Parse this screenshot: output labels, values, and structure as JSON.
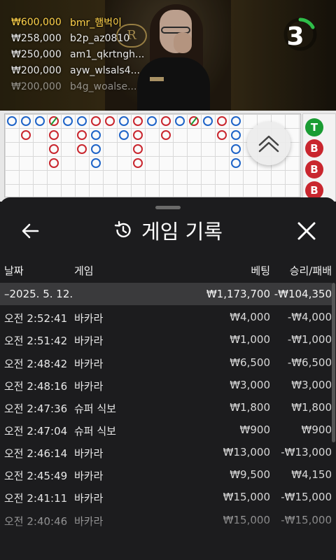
{
  "video": {
    "crest_letter": "R",
    "timer": "3",
    "winners": [
      {
        "amount": "₩600,000",
        "name": "bmr_햄벅이"
      },
      {
        "amount": "₩258,000",
        "name": "b2p_az0810"
      },
      {
        "amount": "₩250,000",
        "name": "am1_qkrtngh..."
      },
      {
        "amount": "₩200,000",
        "name": "ayw_wlsals4..."
      },
      {
        "amount": "₩200,000",
        "name": "b4g_woalse..."
      }
    ]
  },
  "side_road": {
    "labels": [
      "T",
      "B",
      "B",
      "B"
    ]
  },
  "panel": {
    "title": "게임 기록",
    "columns": {
      "date": "날짜",
      "game": "게임",
      "bet": "베팅",
      "result": "승리/패배"
    },
    "day": {
      "date": "–2025. 5. 12.",
      "bet": "₩1,173,700",
      "result": "-₩104,350"
    },
    "rows": [
      {
        "time": "오전 2:52:41",
        "game": "바카라",
        "bet": "₩4,000",
        "result": "-₩4,000"
      },
      {
        "time": "오전 2:51:42",
        "game": "바카라",
        "bet": "₩1,000",
        "result": "-₩1,000"
      },
      {
        "time": "오전 2:48:42",
        "game": "바카라",
        "bet": "₩6,500",
        "result": "-₩6,500"
      },
      {
        "time": "오전 2:48:16",
        "game": "바카라",
        "bet": "₩3,000",
        "result": "₩3,000"
      },
      {
        "time": "오전 2:47:36",
        "game": "슈퍼 식보",
        "bet": "₩1,800",
        "result": "₩1,800"
      },
      {
        "time": "오전 2:47:04",
        "game": "슈퍼 식보",
        "bet": "₩900",
        "result": "₩900"
      },
      {
        "time": "오전 2:46:14",
        "game": "바카라",
        "bet": "₩13,000",
        "result": "-₩13,000"
      },
      {
        "time": "오전 2:45:49",
        "game": "바카라",
        "bet": "₩9,500",
        "result": "₩4,150"
      },
      {
        "time": "오전 2:41:11",
        "game": "바카라",
        "bet": "₩15,000",
        "result": "-₩15,000"
      },
      {
        "time": "오전 2:40:46",
        "game": "바카라",
        "bet": "₩15,000",
        "result": "-₩15,000"
      }
    ]
  },
  "colors": {
    "banker": "#c9262e",
    "player": "#1f64c8",
    "tie": "#1a9c33",
    "panel_bg": "#1c1c1e"
  }
}
